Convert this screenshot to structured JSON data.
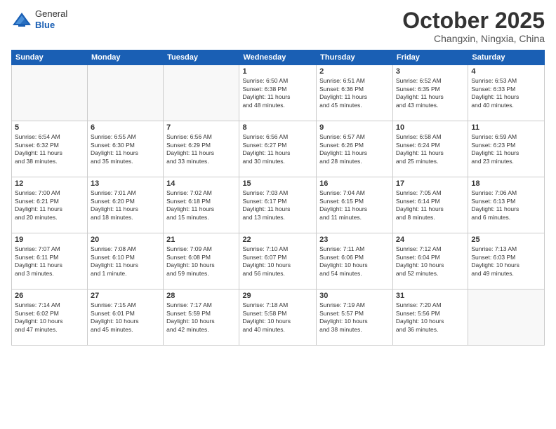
{
  "header": {
    "logo_general": "General",
    "logo_blue": "Blue",
    "title": "October 2025",
    "location": "Changxin, Ningxia, China"
  },
  "weekdays": [
    "Sunday",
    "Monday",
    "Tuesday",
    "Wednesday",
    "Thursday",
    "Friday",
    "Saturday"
  ],
  "weeks": [
    [
      {
        "day": "",
        "info": ""
      },
      {
        "day": "",
        "info": ""
      },
      {
        "day": "",
        "info": ""
      },
      {
        "day": "1",
        "info": "Sunrise: 6:50 AM\nSunset: 6:38 PM\nDaylight: 11 hours\nand 48 minutes."
      },
      {
        "day": "2",
        "info": "Sunrise: 6:51 AM\nSunset: 6:36 PM\nDaylight: 11 hours\nand 45 minutes."
      },
      {
        "day": "3",
        "info": "Sunrise: 6:52 AM\nSunset: 6:35 PM\nDaylight: 11 hours\nand 43 minutes."
      },
      {
        "day": "4",
        "info": "Sunrise: 6:53 AM\nSunset: 6:33 PM\nDaylight: 11 hours\nand 40 minutes."
      }
    ],
    [
      {
        "day": "5",
        "info": "Sunrise: 6:54 AM\nSunset: 6:32 PM\nDaylight: 11 hours\nand 38 minutes."
      },
      {
        "day": "6",
        "info": "Sunrise: 6:55 AM\nSunset: 6:30 PM\nDaylight: 11 hours\nand 35 minutes."
      },
      {
        "day": "7",
        "info": "Sunrise: 6:56 AM\nSunset: 6:29 PM\nDaylight: 11 hours\nand 33 minutes."
      },
      {
        "day": "8",
        "info": "Sunrise: 6:56 AM\nSunset: 6:27 PM\nDaylight: 11 hours\nand 30 minutes."
      },
      {
        "day": "9",
        "info": "Sunrise: 6:57 AM\nSunset: 6:26 PM\nDaylight: 11 hours\nand 28 minutes."
      },
      {
        "day": "10",
        "info": "Sunrise: 6:58 AM\nSunset: 6:24 PM\nDaylight: 11 hours\nand 25 minutes."
      },
      {
        "day": "11",
        "info": "Sunrise: 6:59 AM\nSunset: 6:23 PM\nDaylight: 11 hours\nand 23 minutes."
      }
    ],
    [
      {
        "day": "12",
        "info": "Sunrise: 7:00 AM\nSunset: 6:21 PM\nDaylight: 11 hours\nand 20 minutes."
      },
      {
        "day": "13",
        "info": "Sunrise: 7:01 AM\nSunset: 6:20 PM\nDaylight: 11 hours\nand 18 minutes."
      },
      {
        "day": "14",
        "info": "Sunrise: 7:02 AM\nSunset: 6:18 PM\nDaylight: 11 hours\nand 15 minutes."
      },
      {
        "day": "15",
        "info": "Sunrise: 7:03 AM\nSunset: 6:17 PM\nDaylight: 11 hours\nand 13 minutes."
      },
      {
        "day": "16",
        "info": "Sunrise: 7:04 AM\nSunset: 6:15 PM\nDaylight: 11 hours\nand 11 minutes."
      },
      {
        "day": "17",
        "info": "Sunrise: 7:05 AM\nSunset: 6:14 PM\nDaylight: 11 hours\nand 8 minutes."
      },
      {
        "day": "18",
        "info": "Sunrise: 7:06 AM\nSunset: 6:13 PM\nDaylight: 11 hours\nand 6 minutes."
      }
    ],
    [
      {
        "day": "19",
        "info": "Sunrise: 7:07 AM\nSunset: 6:11 PM\nDaylight: 11 hours\nand 3 minutes."
      },
      {
        "day": "20",
        "info": "Sunrise: 7:08 AM\nSunset: 6:10 PM\nDaylight: 11 hours\nand 1 minute."
      },
      {
        "day": "21",
        "info": "Sunrise: 7:09 AM\nSunset: 6:08 PM\nDaylight: 10 hours\nand 59 minutes."
      },
      {
        "day": "22",
        "info": "Sunrise: 7:10 AM\nSunset: 6:07 PM\nDaylight: 10 hours\nand 56 minutes."
      },
      {
        "day": "23",
        "info": "Sunrise: 7:11 AM\nSunset: 6:06 PM\nDaylight: 10 hours\nand 54 minutes."
      },
      {
        "day": "24",
        "info": "Sunrise: 7:12 AM\nSunset: 6:04 PM\nDaylight: 10 hours\nand 52 minutes."
      },
      {
        "day": "25",
        "info": "Sunrise: 7:13 AM\nSunset: 6:03 PM\nDaylight: 10 hours\nand 49 minutes."
      }
    ],
    [
      {
        "day": "26",
        "info": "Sunrise: 7:14 AM\nSunset: 6:02 PM\nDaylight: 10 hours\nand 47 minutes."
      },
      {
        "day": "27",
        "info": "Sunrise: 7:15 AM\nSunset: 6:01 PM\nDaylight: 10 hours\nand 45 minutes."
      },
      {
        "day": "28",
        "info": "Sunrise: 7:17 AM\nSunset: 5:59 PM\nDaylight: 10 hours\nand 42 minutes."
      },
      {
        "day": "29",
        "info": "Sunrise: 7:18 AM\nSunset: 5:58 PM\nDaylight: 10 hours\nand 40 minutes."
      },
      {
        "day": "30",
        "info": "Sunrise: 7:19 AM\nSunset: 5:57 PM\nDaylight: 10 hours\nand 38 minutes."
      },
      {
        "day": "31",
        "info": "Sunrise: 7:20 AM\nSunset: 5:56 PM\nDaylight: 10 hours\nand 36 minutes."
      },
      {
        "day": "",
        "info": ""
      }
    ]
  ]
}
